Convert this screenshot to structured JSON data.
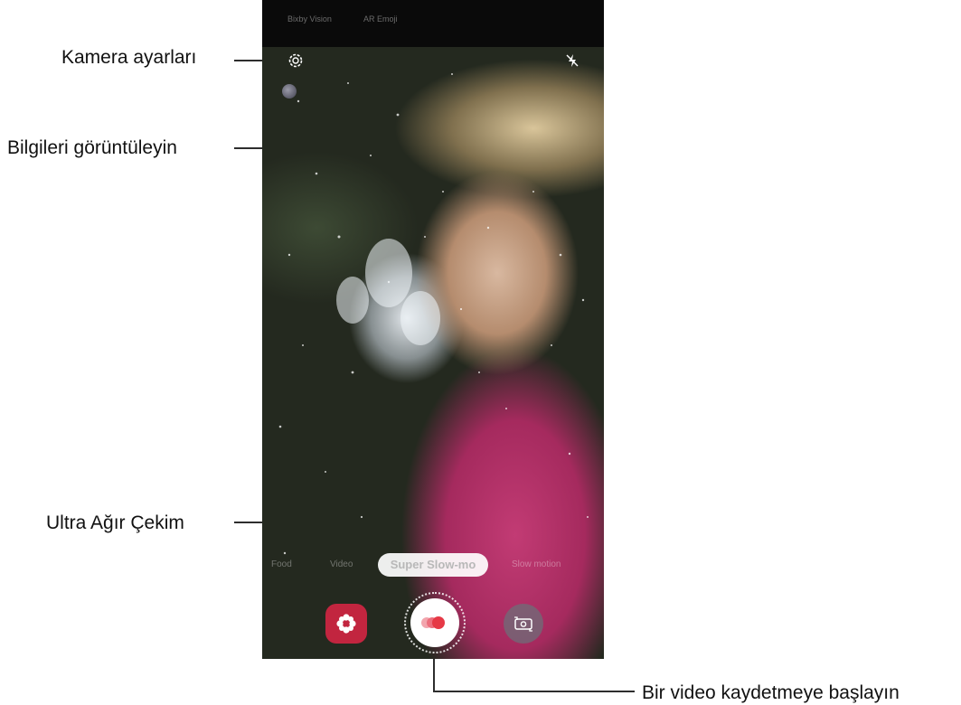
{
  "callouts": {
    "camera_settings": "Kamera ayarları",
    "view_info": "Bilgileri görüntüleyin",
    "super_slow_mo": "Ultra Ağır Çekim",
    "start_recording": "Bir video kaydetmeye başlayın"
  },
  "camera": {
    "top_tabs": [
      "Bixby Vision",
      "AR Emoji"
    ],
    "modes_visible": [
      "Food",
      "Video",
      "Super Slow-mo",
      "Slow motion"
    ],
    "current_mode": "Super Slow-mo"
  },
  "icons": {
    "settings": "gear-icon",
    "flash": "flash-off-icon",
    "info": "info-dot-icon",
    "gallery": "gallery-icon",
    "record": "super-slow-mo-record-icon",
    "switch_camera": "switch-camera-icon"
  },
  "colors": {
    "gallery_button": "#c2253f",
    "record_dot": "#e63946",
    "callout_line": "#2d2d2d"
  }
}
